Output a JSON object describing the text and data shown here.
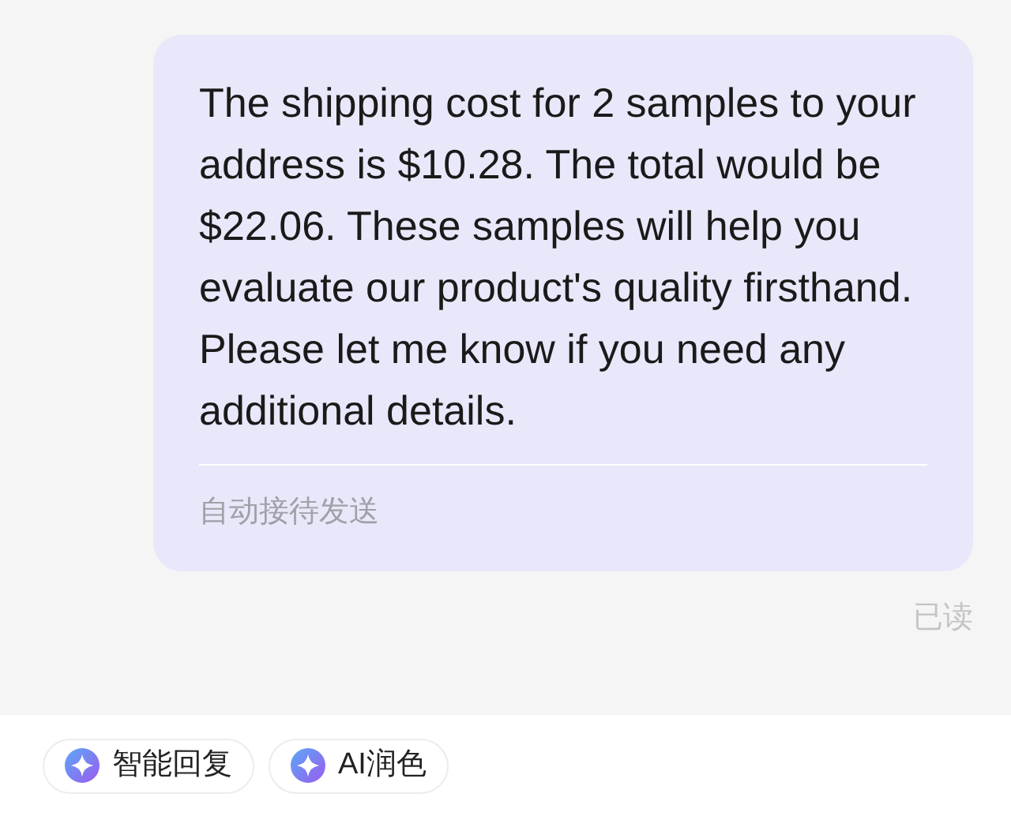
{
  "message": {
    "text": "The shipping cost for 2 samples to your address is $10.28. The total would be $22.06. These samples will help you evaluate our product's quality firsthand. Please let me know if you need any additional details.",
    "footer": "自动接待发送",
    "status": "已读"
  },
  "actions": [
    {
      "label": "智能回复"
    },
    {
      "label": "AI润色"
    }
  ]
}
